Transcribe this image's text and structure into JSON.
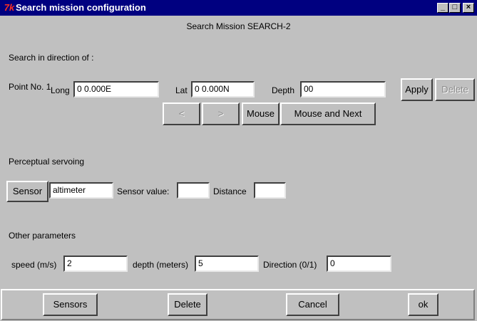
{
  "window": {
    "title": "Search mission configuration",
    "app_icon": "tk-feather-icon",
    "controls": {
      "minimize": "_",
      "maximize": "□",
      "close": "×"
    }
  },
  "header": {
    "mission_title": "Search Mission SEARCH-2"
  },
  "direction_section": {
    "heading": "Search in direction of :",
    "point_label": "Point No.",
    "point_number": "1",
    "long_label": "Long",
    "long_value": "0 0.000E",
    "lat_label": "Lat",
    "lat_value": "0 0.000N",
    "depth_label": "Depth",
    "depth_value": "00",
    "apply_label": "Apply",
    "delete_label": "Delete",
    "prev_label": "<",
    "next_label": ">",
    "mouse_label": "Mouse",
    "mouse_next_label": "Mouse and Next"
  },
  "servoing_section": {
    "heading": "Perceptual servoing",
    "sensor_button": "Sensor",
    "sensor_value": "altimeter",
    "sensor_value_label": "Sensor value:",
    "sensor_value_field": "",
    "distance_label": "Distance",
    "distance_field": ""
  },
  "params_section": {
    "heading": "Other parameters",
    "speed_label": "speed (m/s)",
    "speed_value": "2",
    "depth_label": "depth (meters)",
    "depth_value": "5",
    "direction_label": "Direction (0/1)",
    "direction_value": "0"
  },
  "footer": {
    "sensors_label": "Sensors",
    "delete_label": "Delete",
    "cancel_label": "Cancel",
    "ok_label": "ok"
  }
}
